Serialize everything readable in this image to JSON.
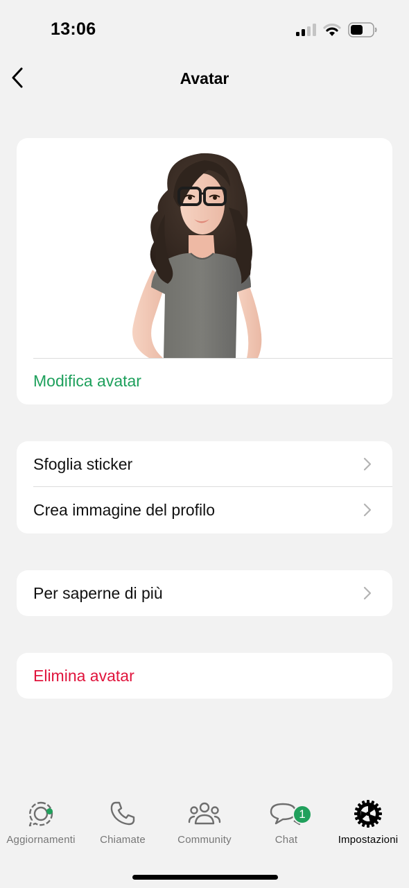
{
  "status_bar": {
    "time": "13:06",
    "signal_bars": 2,
    "wifi_strength": 1,
    "battery_level": 0.5
  },
  "nav": {
    "back_icon": "chevron-left-icon",
    "title": "Avatar"
  },
  "avatar_card": {
    "image": "3d-avatar-woman-glasses-grey-tshirt",
    "edit_label": "Modifica avatar"
  },
  "groups": {
    "stickers": {
      "items": [
        {
          "label": "Sfoglia sticker",
          "icon": "chevron-right-icon"
        },
        {
          "label": "Crea immagine del profilo",
          "icon": "chevron-right-icon"
        }
      ]
    },
    "learn": {
      "label": "Per saperne di più",
      "icon": "chevron-right-icon"
    },
    "delete": {
      "label": "Elimina avatar"
    }
  },
  "tab_bar": {
    "tabs": [
      {
        "label": "Aggiornamenti",
        "icon": "updates-icon",
        "has_dot": true
      },
      {
        "label": "Chiamate",
        "icon": "phone-icon"
      },
      {
        "label": "Community",
        "icon": "community-icon"
      },
      {
        "label": "Chat",
        "icon": "chat-icon",
        "badge": "1"
      },
      {
        "label": "Impostazioni",
        "icon": "settings-icon",
        "active": true
      }
    ]
  },
  "colors": {
    "accent_green": "#1ea05c",
    "danger_red": "#e0143c",
    "background": "#f2f2f2"
  }
}
